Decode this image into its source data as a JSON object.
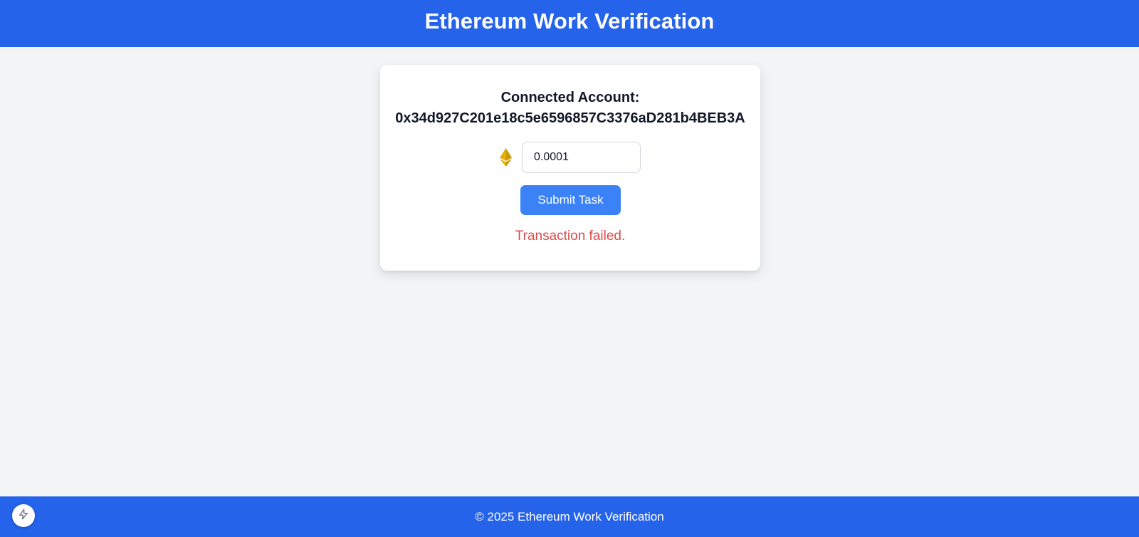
{
  "header": {
    "title": "Ethereum Work Verification"
  },
  "card": {
    "account_label": "Connected Account:",
    "account_address": "0x34d927C201e18c5e6596857C3376aD281b4BEB3A",
    "amount_icon": "ethereum-icon",
    "amount_value": "0.0001",
    "submit_label": "Submit Task",
    "status_message": "Transaction failed."
  },
  "footer": {
    "text": "© 2025 Ethereum Work Verification"
  },
  "floating_button": {
    "icon": "lightning-icon"
  },
  "colors": {
    "brand": "#2563eb",
    "button": "#3b82f6",
    "error": "#dc4a4a",
    "eth_icon": "#e3b20c",
    "background": "#f3f4f6"
  }
}
